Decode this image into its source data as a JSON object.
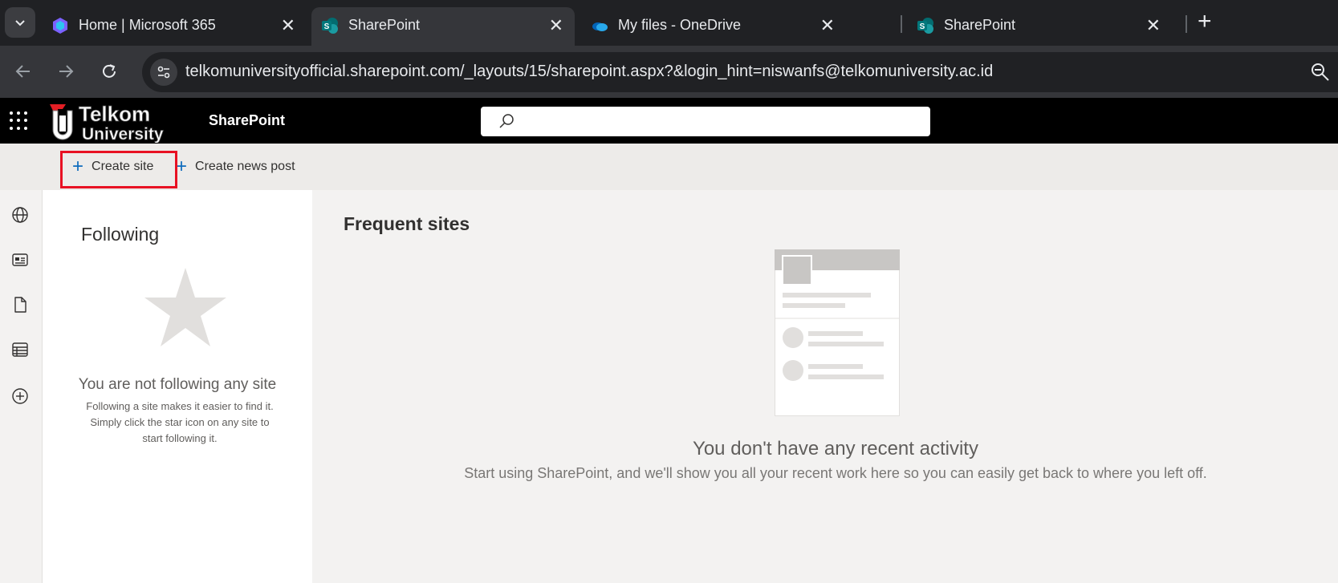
{
  "browser": {
    "tabs": [
      {
        "title": "Home | Microsoft 365",
        "icon": "microsoft365-icon",
        "active": false
      },
      {
        "title": "SharePoint",
        "icon": "sharepoint-icon",
        "active": true
      },
      {
        "title": "My files - OneDrive",
        "icon": "onedrive-icon",
        "active": false
      },
      {
        "title": "SharePoint",
        "icon": "sharepoint-icon",
        "active": false
      }
    ],
    "url": "telkomuniversityofficial.sharepoint.com/_layouts/15/sharepoint.aspx?&login_hint=niswanfs@telkomuniversity.ac.id"
  },
  "header": {
    "app_title": "SharePoint",
    "logo_text_top": "Telkom",
    "logo_text_bottom": "University"
  },
  "commands": {
    "create_site": "Create site",
    "create_news_post": "Create news post"
  },
  "rail": [
    "home-icon",
    "globe-icon",
    "news-icon",
    "file-icon",
    "lists-icon",
    "add-circle-icon"
  ],
  "following": {
    "heading": "Following",
    "empty_title": "You are not following any site",
    "empty_desc": "Following a site makes it easier to find it. Simply click the star icon on any site to start following it."
  },
  "main": {
    "heading": "Frequent sites",
    "empty_title": "You don't have any recent activity",
    "empty_desc": "Start using SharePoint, and we'll show you all your recent work here so you can easily get back to where you left off."
  },
  "colors": {
    "accent": "#0f6cbd",
    "highlight": "#e81123",
    "header_bg": "#000000"
  }
}
